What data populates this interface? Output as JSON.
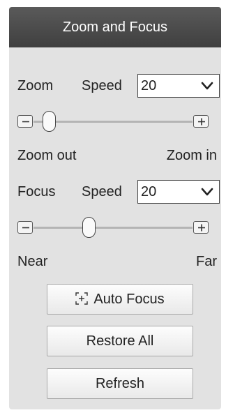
{
  "panel": {
    "title": "Zoom and Focus"
  },
  "zoom": {
    "label": "Zoom",
    "speed_label": "Speed",
    "speed_value": "20",
    "minus_label": "Zoom out",
    "plus_label": "Zoom in",
    "slider_fraction": 0.1
  },
  "focus": {
    "label": "Focus",
    "speed_label": "Speed",
    "speed_value": "20",
    "minus_label": "Near",
    "plus_label": "Far",
    "slider_fraction": 0.35
  },
  "buttons": {
    "auto_focus": "Auto Focus",
    "restore_all": "Restore All",
    "refresh": "Refresh"
  },
  "icons": {
    "dropdown": "chevron-down-icon",
    "decrease": "minus-icon",
    "increase": "plus-icon",
    "auto_focus": "focus-frame-icon"
  },
  "colors": {
    "header_bg": "#4a4a4a",
    "panel_bg": "#e2e2e2",
    "button_bg": "#f5f5f5"
  }
}
